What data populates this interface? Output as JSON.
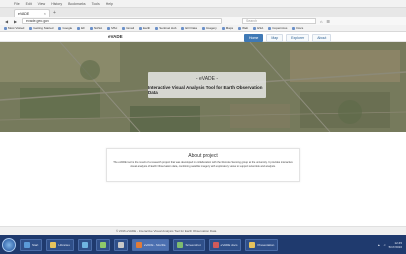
{
  "menubar": {
    "items": [
      "File",
      "Edit",
      "View",
      "History",
      "Bookmarks",
      "Tools",
      "Help"
    ]
  },
  "tab": {
    "title": "eVADE",
    "close": "×",
    "newtab": "+"
  },
  "toolbar": {
    "url": "evade.geo.gov",
    "search_placeholder": "Search"
  },
  "bookmarks": [
    "Most Visited",
    "Getting Started",
    "Google",
    "EF",
    "NASA",
    "MSc",
    "Gmail",
    "Earth",
    "Sentinel Hub",
    "EO Data",
    "Imagery",
    "Maps",
    "Web",
    "ESA",
    "Copernicus",
    "Docs"
  ],
  "navbar": {
    "brand": "eVADE",
    "links": [
      "Home",
      "Map",
      "Explorer",
      "About"
    ]
  },
  "hero": {
    "title": "- eVADE -",
    "subtitle": "Interactive Visual Analysis Tool for Earth Observation Data"
  },
  "about": {
    "title": "About project",
    "text": "The eVADE tool is the result of a research project that was developed in collaboration with the Remote Sensing group at the university. It provides interactive visual analysis of Earth Observation data, combining satellite imagery with exploratory views to support scientists and analysts."
  },
  "footer": {
    "text": "© 2016 eVADE - Interactive Visual Analysis Tool for Earth Observation Data"
  },
  "taskbar": {
    "tasks": [
      {
        "label": "Start",
        "color": "#5a9ad8"
      },
      {
        "label": "Libraries",
        "color": "#e6c35c"
      },
      {
        "label": "",
        "color": "#6fb3e0"
      },
      {
        "label": "",
        "color": "#8fc96a"
      },
      {
        "label": "",
        "color": "#c9c9c9"
      },
      {
        "label": "eVADE - Mozilla",
        "color": "#e07b39",
        "active": true
      },
      {
        "label": "Screenshot",
        "color": "#7dbb6f"
      },
      {
        "label": "eVADE docs",
        "color": "#d15a5a"
      },
      {
        "label": "Presentation",
        "color": "#e6c35c"
      }
    ],
    "clock": "12:45",
    "date": "5/17/2016"
  }
}
